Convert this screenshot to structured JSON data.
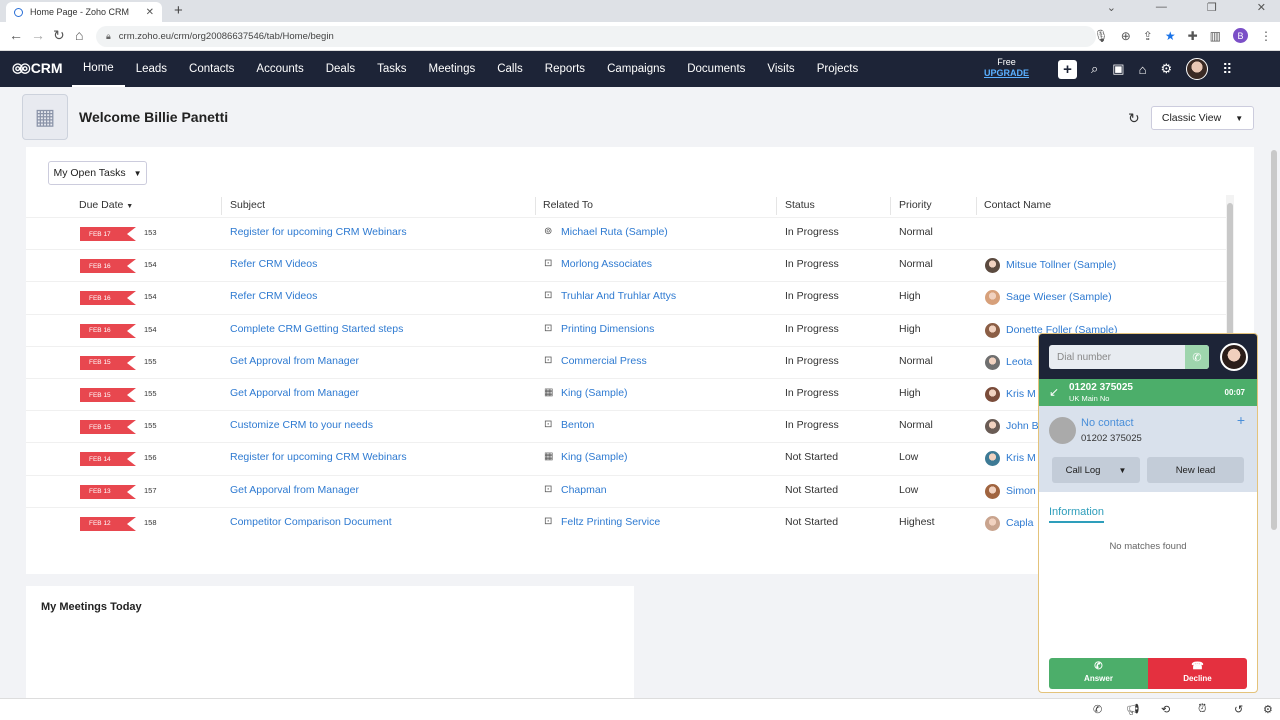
{
  "browser": {
    "tab_title": "Home Page - Zoho CRM",
    "url": "crm.zoho.eu/crm/org20086637546/tab/Home/begin",
    "profile_initial": "B"
  },
  "nav": {
    "logo": "CRM",
    "links": [
      "Home",
      "Leads",
      "Contacts",
      "Accounts",
      "Deals",
      "Tasks",
      "Meetings",
      "Calls",
      "Reports",
      "Campaigns",
      "Documents",
      "Visits",
      "Projects"
    ],
    "free_label": "Free",
    "upgrade_label": "UPGRADE"
  },
  "home": {
    "welcome": "Welcome Billie Panetti",
    "view_select": "Classic View"
  },
  "tasks": {
    "filter_label": "My Open Tasks",
    "headers": {
      "due": "Due Date",
      "subject": "Subject",
      "related": "Related To",
      "status": "Status",
      "priority": "Priority",
      "contact": "Contact Name"
    },
    "rows": [
      {
        "due": "FEB 17",
        "days": "153",
        "subject": "Register for upcoming CRM Webinars",
        "related": "Michael Ruta (Sample)",
        "related_icon": "contact-icon",
        "status": "In Progress",
        "priority": "Normal",
        "contact": ""
      },
      {
        "due": "FEB 16",
        "days": "154",
        "subject": "Refer CRM Videos",
        "related": "Morlong Associates",
        "related_icon": "account-icon",
        "status": "In Progress",
        "priority": "Normal",
        "contact": "Mitsue Tollner (Sample)"
      },
      {
        "due": "FEB 16",
        "days": "154",
        "subject": "Refer CRM Videos",
        "related": "Truhlar And Truhlar Attys",
        "related_icon": "account-icon",
        "status": "In Progress",
        "priority": "High",
        "contact": "Sage Wieser (Sample)"
      },
      {
        "due": "FEB 16",
        "days": "154",
        "subject": "Complete CRM Getting Started steps",
        "related": "Printing Dimensions",
        "related_icon": "account-icon",
        "status": "In Progress",
        "priority": "High",
        "contact": "Donette Foller (Sample)"
      },
      {
        "due": "FEB 15",
        "days": "155",
        "subject": "Get Approval from Manager",
        "related": "Commercial Press",
        "related_icon": "account-icon",
        "status": "In Progress",
        "priority": "Normal",
        "contact": "Leota"
      },
      {
        "due": "FEB 15",
        "days": "155",
        "subject": "Get Apporval from Manager",
        "related": "King (Sample)",
        "related_icon": "building-icon",
        "status": "In Progress",
        "priority": "High",
        "contact": "Kris M"
      },
      {
        "due": "FEB 15",
        "days": "155",
        "subject": "Customize CRM to your needs",
        "related": "Benton",
        "related_icon": "account-icon",
        "status": "In Progress",
        "priority": "Normal",
        "contact": "John B"
      },
      {
        "due": "FEB 14",
        "days": "156",
        "subject": "Register for upcoming CRM Webinars",
        "related": "King (Sample)",
        "related_icon": "building-icon",
        "status": "Not Started",
        "priority": "Low",
        "contact": "Kris M"
      },
      {
        "due": "FEB 13",
        "days": "157",
        "subject": "Get Apporval from Manager",
        "related": "Chapman",
        "related_icon": "account-icon",
        "status": "Not Started",
        "priority": "Low",
        "contact": "Simon"
      },
      {
        "due": "FEB 12",
        "days": "158",
        "subject": "Competitor Comparison Document",
        "related": "Feltz Printing Service",
        "related_icon": "account-icon",
        "status": "Not Started",
        "priority": "Highest",
        "contact": "Capla"
      }
    ]
  },
  "meetings": {
    "title": "My Meetings Today"
  },
  "phone": {
    "dial_placeholder": "Dial number",
    "caller_number": "01202 375025",
    "line_name": "UK Main No",
    "timer": "00:07",
    "contact_name": "No contact",
    "contact_number": "01202 375025",
    "call_log_label": "Call Log",
    "new_lead_label": "New lead",
    "info_tab": "Information",
    "no_matches": "No matches found",
    "answer_label": "Answer",
    "decline_label": "Decline",
    "colors": {
      "answer": "#4cae6a",
      "decline": "#e4303f"
    }
  }
}
